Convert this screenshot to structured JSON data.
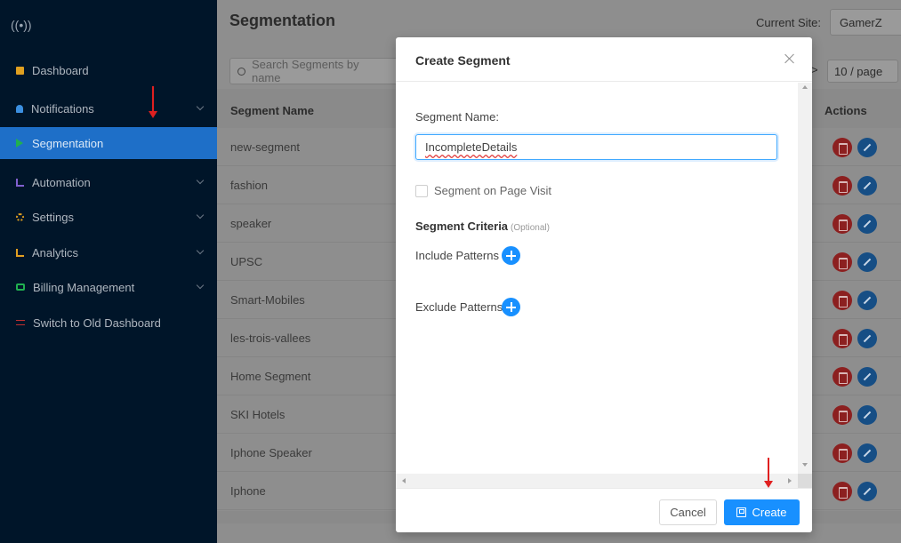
{
  "sidebar": {
    "logo": "((•))",
    "items": [
      {
        "label": "Dashboard",
        "icon": "dashboard-icon",
        "color": "#e0a020"
      },
      {
        "label": "Notifications",
        "icon": "bell-icon",
        "color": "#3b8fe0"
      },
      {
        "label": "Segmentation",
        "icon": "play-icon",
        "color": "#20b050"
      },
      {
        "label": "Automation",
        "icon": "automation-icon",
        "color": "#8060d0"
      },
      {
        "label": "Settings",
        "icon": "gear-icon",
        "color": "#e0a020"
      },
      {
        "label": "Analytics",
        "icon": "analytics-icon",
        "color": "#e0a020"
      },
      {
        "label": "Billing Management",
        "icon": "billing-icon",
        "color": "#20b050"
      },
      {
        "label": "Switch to Old Dashboard",
        "icon": "switch-icon",
        "color": "#c03030"
      }
    ],
    "active": "Segmentation"
  },
  "header": {
    "title": "Segmentation",
    "current_site_label": "Current Site:",
    "current_site_value": "GamerZ"
  },
  "toolbar": {
    "search_placeholder": "Search Segments by name",
    "page_size": "10 / page"
  },
  "table": {
    "columns": [
      "Segment Name",
      "Actions"
    ],
    "rows": [
      "new-segment",
      "fashion",
      "speaker",
      "UPSC",
      "Smart-Mobiles",
      "les-trois-vallees",
      "Home Segment",
      "SKI Hotels",
      "Iphone Speaker",
      "Iphone"
    ]
  },
  "modal": {
    "title": "Create Segment",
    "name_label": "Segment Name:",
    "name_value": "IncompleteDetails",
    "page_visit_label": "Segment on Page Visit",
    "criteria_label": "Segment Criteria",
    "criteria_optional": "(Optional)",
    "include_label": "Include Patterns",
    "exclude_label": "Exclude Patterns",
    "cancel_label": "Cancel",
    "create_label": "Create"
  },
  "colors": {
    "primary": "#1890ff",
    "sidebar_bg": "#001529",
    "active_item": "#1e6fc8",
    "annotation_arrow": "#e02020"
  }
}
